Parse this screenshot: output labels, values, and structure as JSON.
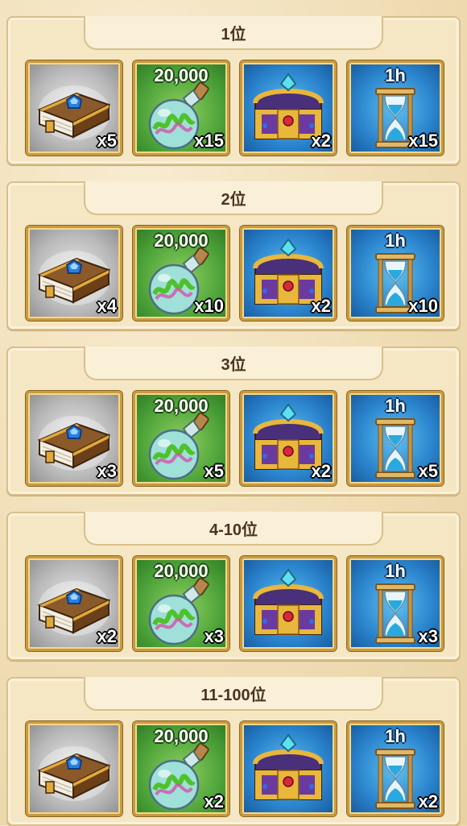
{
  "tiers": [
    {
      "rank": "1位",
      "items": [
        {
          "icon": "skill-book-icon",
          "label": "",
          "qty": "x5"
        },
        {
          "icon": "potion-flask-icon",
          "label": "20,000",
          "qty": "x15"
        },
        {
          "icon": "treasure-chest-icon",
          "label": "",
          "qty": "x2"
        },
        {
          "icon": "hourglass-icon",
          "label": "1h",
          "qty": "x15"
        }
      ]
    },
    {
      "rank": "2位",
      "items": [
        {
          "icon": "skill-book-icon",
          "label": "",
          "qty": "x4"
        },
        {
          "icon": "potion-flask-icon",
          "label": "20,000",
          "qty": "x10"
        },
        {
          "icon": "treasure-chest-icon",
          "label": "",
          "qty": "x2"
        },
        {
          "icon": "hourglass-icon",
          "label": "1h",
          "qty": "x10"
        }
      ]
    },
    {
      "rank": "3位",
      "items": [
        {
          "icon": "skill-book-icon",
          "label": "",
          "qty": "x3"
        },
        {
          "icon": "potion-flask-icon",
          "label": "20,000",
          "qty": "x5"
        },
        {
          "icon": "treasure-chest-icon",
          "label": "",
          "qty": "x2"
        },
        {
          "icon": "hourglass-icon",
          "label": "1h",
          "qty": "x5"
        }
      ]
    },
    {
      "rank": "4-10位",
      "items": [
        {
          "icon": "skill-book-icon",
          "label": "",
          "qty": "x2"
        },
        {
          "icon": "potion-flask-icon",
          "label": "20,000",
          "qty": "x3"
        },
        {
          "icon": "treasure-chest-icon",
          "label": "",
          "qty": ""
        },
        {
          "icon": "hourglass-icon",
          "label": "1h",
          "qty": "x3"
        }
      ]
    },
    {
      "rank": "11-100位",
      "items": [
        {
          "icon": "skill-book-icon",
          "label": "",
          "qty": ""
        },
        {
          "icon": "potion-flask-icon",
          "label": "20,000",
          "qty": "x2"
        },
        {
          "icon": "treasure-chest-icon",
          "label": "",
          "qty": ""
        },
        {
          "icon": "hourglass-icon",
          "label": "1h",
          "qty": "x2"
        }
      ]
    }
  ],
  "colors": {
    "panel_bg": "#f5e7c4",
    "border_gold": "#c99a3e",
    "text_dark": "#4a3520"
  }
}
